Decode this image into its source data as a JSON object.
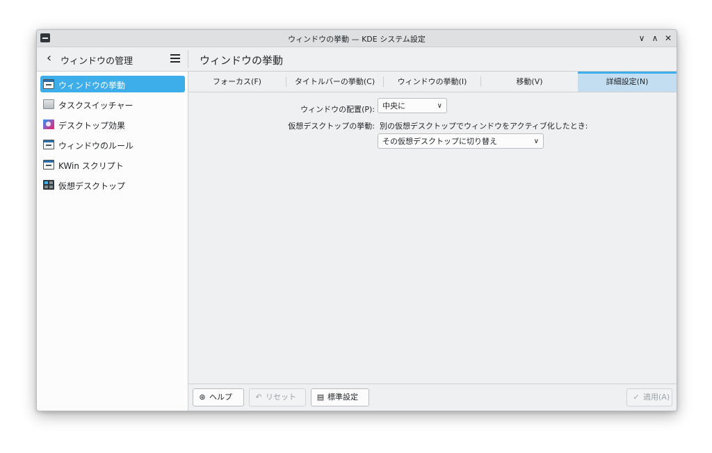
{
  "window": {
    "title": "ウィンドウの挙動 — KDE システム設定",
    "controls": {
      "minimize": "∨",
      "maximize": "∧",
      "close": "✕"
    }
  },
  "header": {
    "sidebar_title": "ウィンドウの管理",
    "page_title": "ウィンドウの挙動"
  },
  "sidebar": {
    "items": [
      {
        "label": "ウィンドウの挙動",
        "icon": "window-behavior-icon",
        "active": true
      },
      {
        "label": "タスクスイッチャー",
        "icon": "task-switcher-icon",
        "active": false
      },
      {
        "label": "デスクトップ効果",
        "icon": "desktop-effects-icon",
        "active": false
      },
      {
        "label": "ウィンドウのルール",
        "icon": "window-rules-icon",
        "active": false
      },
      {
        "label": "KWin スクリプト",
        "icon": "kwin-scripts-icon",
        "active": false
      },
      {
        "label": "仮想デスクトップ",
        "icon": "virtual-desktops-icon",
        "active": false
      }
    ]
  },
  "tabs": [
    {
      "label": "フォーカス(F)",
      "active": false
    },
    {
      "label": "タイトルバーの挙動(C)",
      "active": false
    },
    {
      "label": "ウィンドウの挙動(I)",
      "active": false
    },
    {
      "label": "移動(V)",
      "active": false
    },
    {
      "label": "詳細設定(N)",
      "active": true
    }
  ],
  "form": {
    "placement_label": "ウィンドウの配置(P):",
    "placement_value": "中央に",
    "vd_label": "仮想デスクトップの挙動:",
    "vd_description": "別の仮想デスクトップでウィンドウをアクティブ化したとき:",
    "vd_value": "その仮想デスクトップに切り替え"
  },
  "buttons": {
    "help": "ヘルプ(H)",
    "reset": "リセット(R)",
    "defaults": "標準設定(D)",
    "apply": "適用(A)"
  },
  "colors": {
    "accent": "#3daee9",
    "active_tab_bg": "#c2def0",
    "window_bg": "#eff0f1"
  }
}
